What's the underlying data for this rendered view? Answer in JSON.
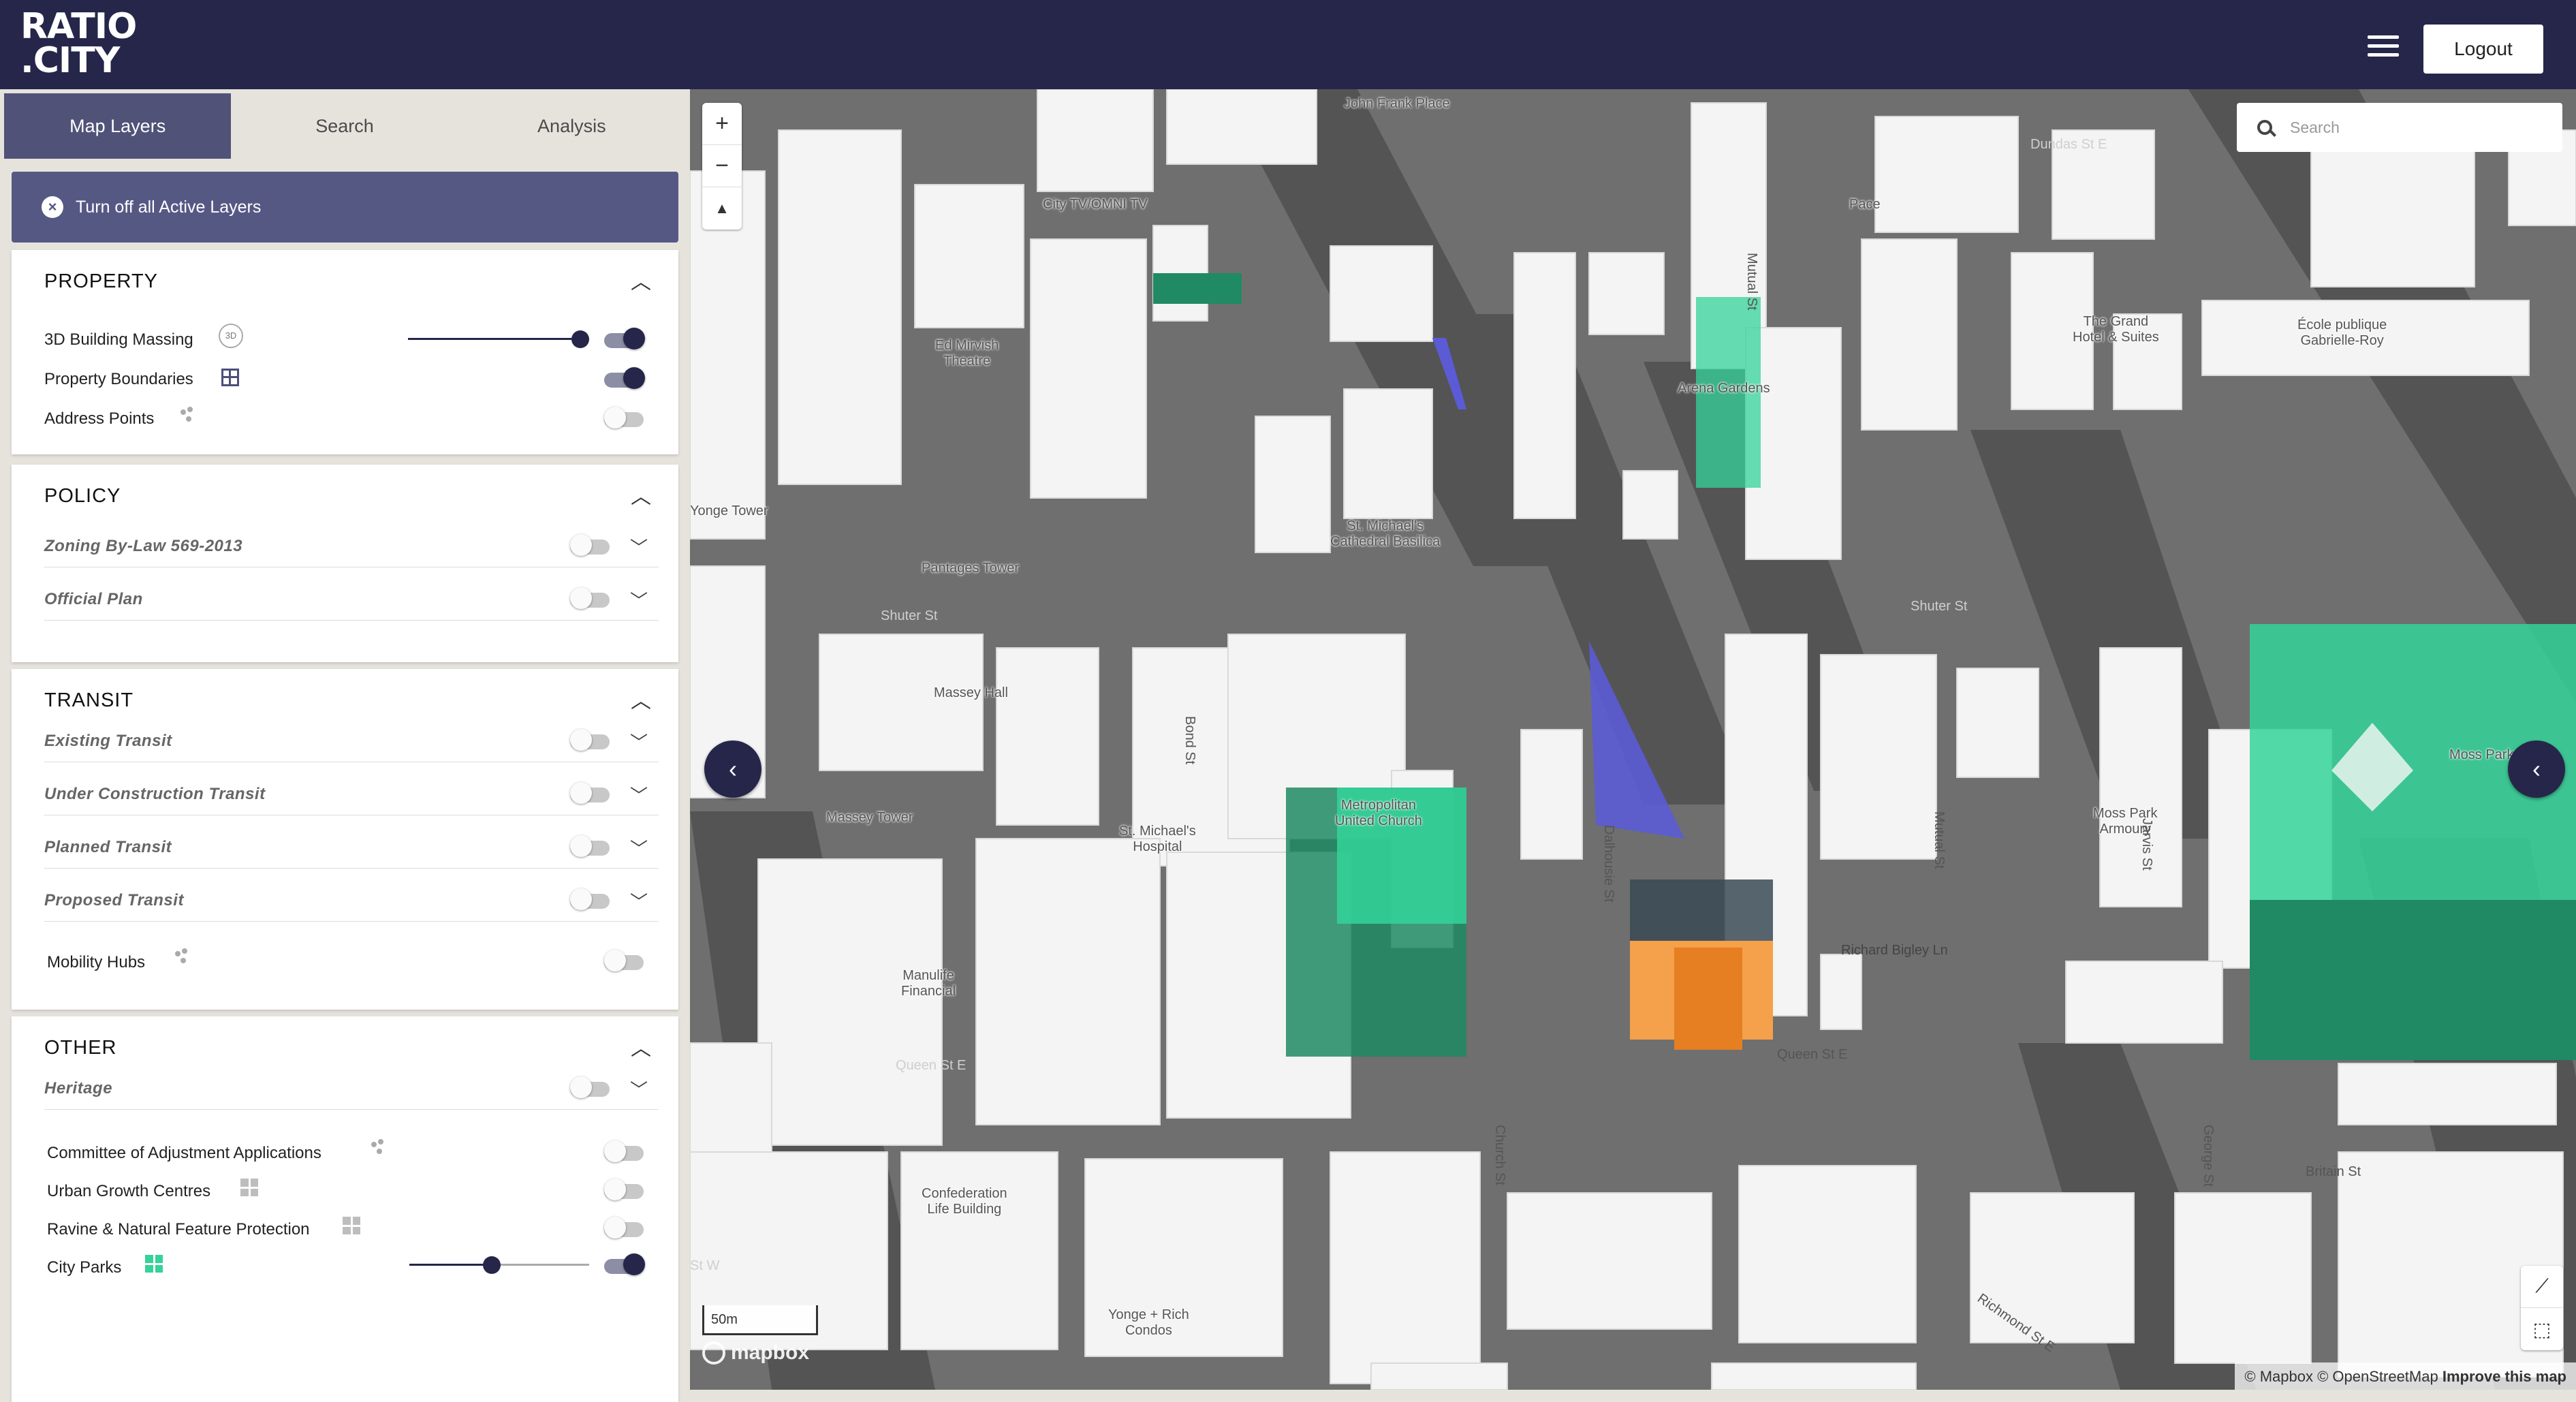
{
  "app": {
    "logo_line1": "RATIO",
    "logo_line2": ".CITY",
    "logout_label": "Logout",
    "menu_icon": "hamburger-icon"
  },
  "sidebar": {
    "tabs": [
      {
        "label": "Map Layers",
        "active": true
      },
      {
        "label": "Search",
        "active": false
      },
      {
        "label": "Analysis",
        "active": false
      }
    ],
    "turn_off_label": "Turn off all Active Layers",
    "sections": {
      "property": {
        "title": "PROPERTY",
        "rows": [
          {
            "label": "3D Building Massing",
            "icon": "3d-icon",
            "enabled": true,
            "opacity": 1.0
          },
          {
            "label": "Property Boundaries",
            "icon": "grid-icon",
            "enabled": true
          },
          {
            "label": "Address Points",
            "icon": "dots-icon",
            "enabled": false
          }
        ]
      },
      "policy": {
        "title": "POLICY",
        "rows": [
          {
            "label": "Zoning By-Law 569-2013",
            "enabled": false
          },
          {
            "label": "Official Plan",
            "enabled": false
          }
        ]
      },
      "transit": {
        "title": "TRANSIT",
        "rows": [
          {
            "label": "Existing Transit",
            "enabled": false
          },
          {
            "label": "Under Construction Transit",
            "enabled": false
          },
          {
            "label": "Planned Transit",
            "enabled": false
          },
          {
            "label": "Proposed Transit",
            "enabled": false
          },
          {
            "label": "Mobility Hubs",
            "icon": "dots-icon",
            "enabled": false
          }
        ]
      },
      "other": {
        "title": "OTHER",
        "rows": [
          {
            "label": "Heritage",
            "enabled": false
          },
          {
            "label": "Committee of Adjustment Applications",
            "icon": "dots-icon",
            "enabled": false
          },
          {
            "label": "Urban Growth Centres",
            "icon": "squares-icon",
            "enabled": false
          },
          {
            "label": "Ravine & Natural Feature Protection",
            "icon": "squares-icon",
            "enabled": false
          },
          {
            "label": "City Parks",
            "icon": "green-squares-icon",
            "enabled": true,
            "opacity": 0.5
          }
        ]
      }
    }
  },
  "map": {
    "search_placeholder": "Search",
    "zoom_in": "+",
    "zoom_out": "−",
    "compass": "▲",
    "scale_label": "50m",
    "logo_text": "mapbox",
    "attribution": "© Mapbox © OpenStreetMap",
    "improve": "Improve this map",
    "colors": {
      "park": "#34d399",
      "park_dark": "#1f8a63",
      "building": "#ffffff",
      "road": "#6e6e6e",
      "selected": "#e67e22",
      "shadow_purple": "#5b5bd6"
    },
    "labels": {
      "john_frank": "John Frank Place",
      "city_tv": "City TV/OMNI TV",
      "dundas": "Dundas St E",
      "pace": "Pace",
      "mutual_top": "Mutual St",
      "mirvish": "Ed Mirvish\nTheatre",
      "grand_hotel": "The Grand\nHotel & Suites",
      "ecole": "École publique\nGabrielle-Roy",
      "arena_gardens": "Arena Gardens",
      "yonge_tower": "Yonge Tower",
      "st_michaels_cathedral": "St. Michael's\nCathedral Basilica",
      "pantages": "Pantages Tower",
      "shuter_w": "Shuter St",
      "shuter_e": "Shuter St",
      "massey_hall": "Massey Hall",
      "bond": "Bond St",
      "metropolitan": "Metropolitan\nUnited Church",
      "dalhousie": "Dalhousie St",
      "mutual_mid": "Mutual St",
      "jarvis": "Jarvis St",
      "moss_park_armoury": "Moss Park\nArmoury",
      "moss_park": "Moss Park",
      "massey_tower": "Massey Tower",
      "st_michaels_hospital": "St. Michael's\nHospital",
      "manulife": "Manulife\nFinancial",
      "richard_bigley": "Richard Bigley Ln",
      "queen_w": "Queen St E",
      "queen_e": "Queen St E",
      "church": "Church St",
      "george": "George St",
      "britain": "Britain St",
      "confederation": "Confederation\nLife Building",
      "yonge_rich": "Yonge + Rich\nCondos",
      "richmond": "Richmond St E",
      "st_w": "St W"
    }
  }
}
